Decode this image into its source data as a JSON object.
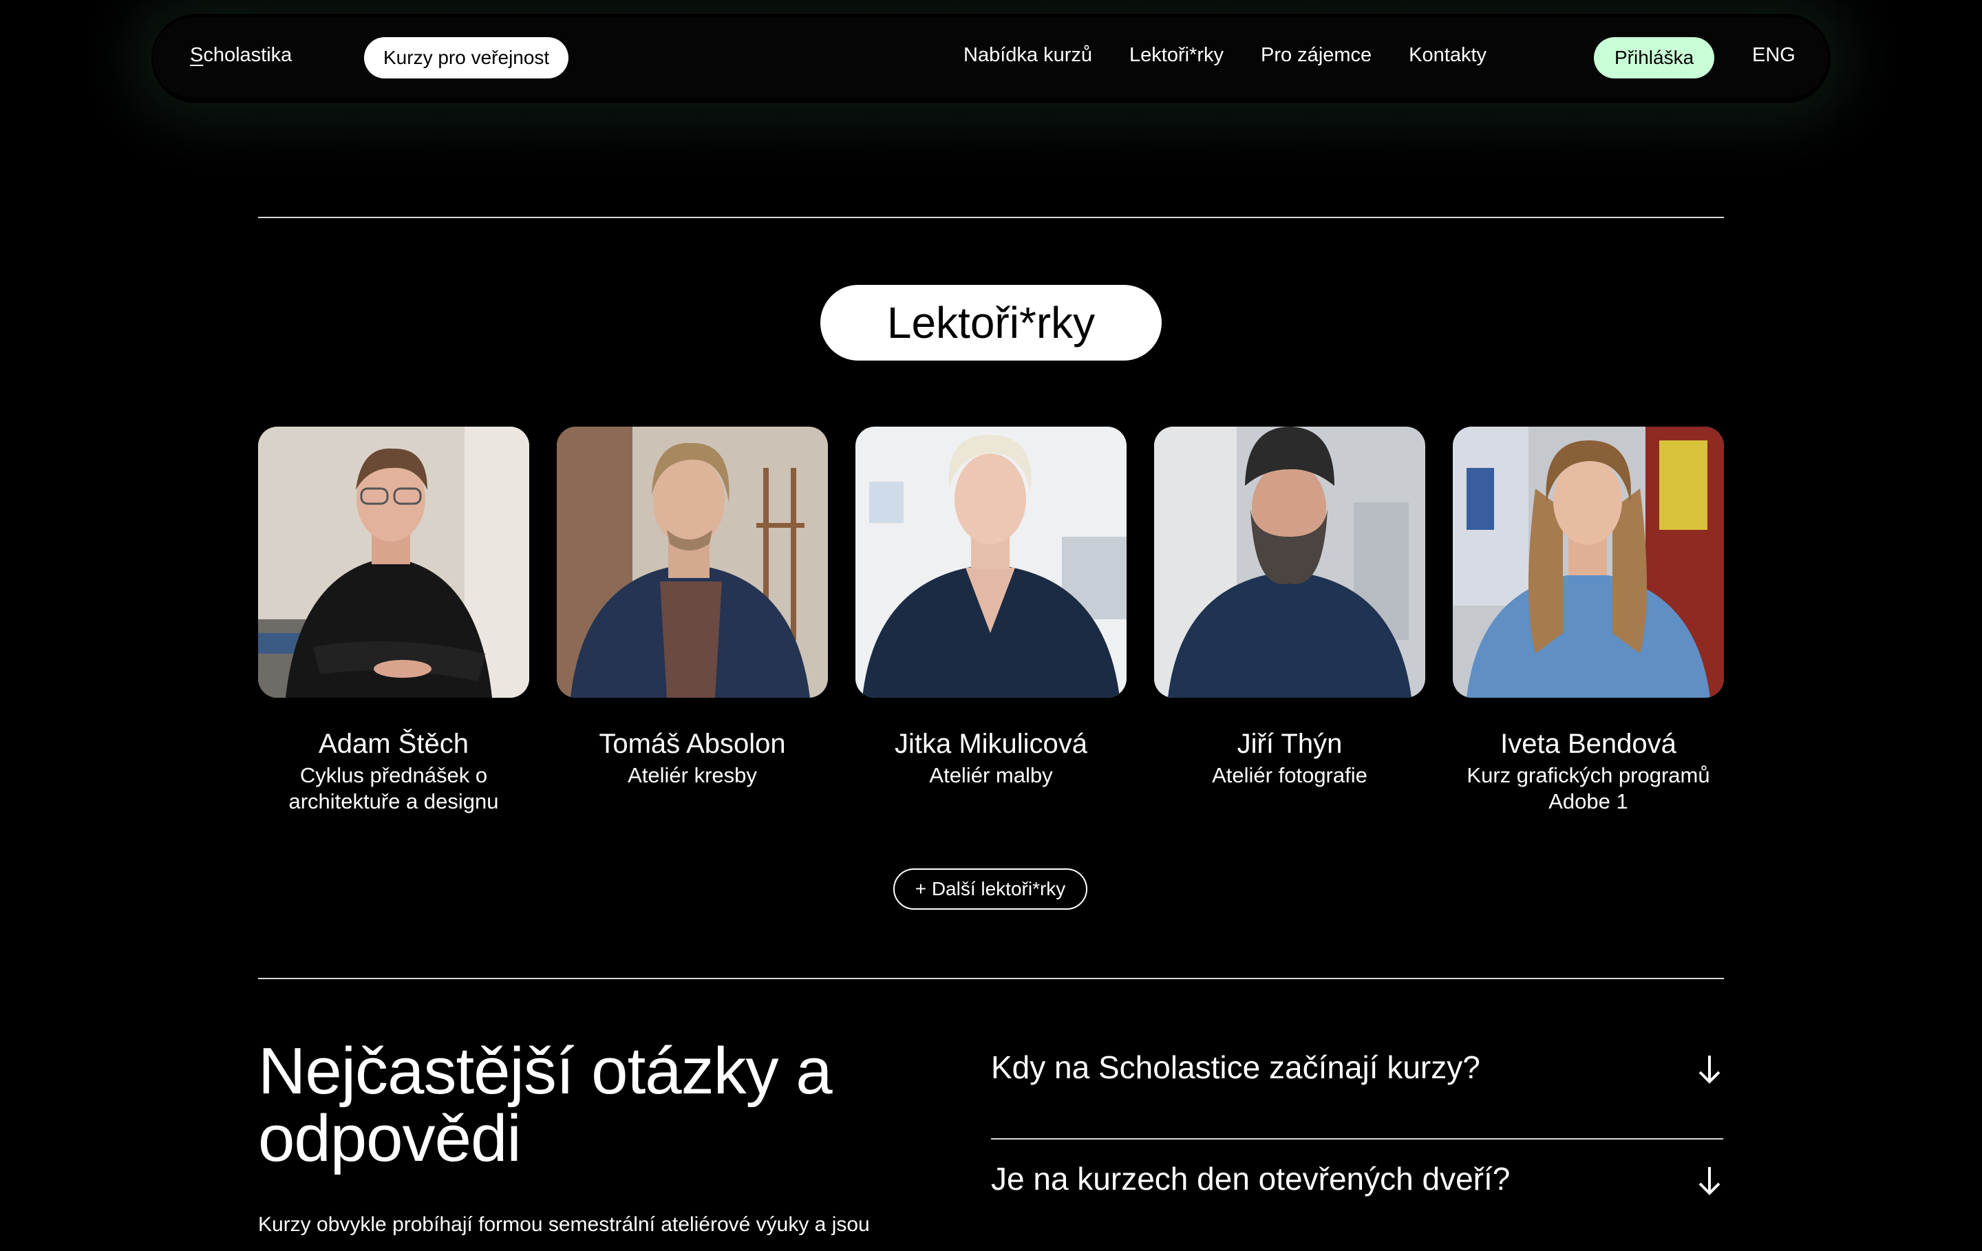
{
  "nav": {
    "brand_first": "S",
    "brand_rest": "cholastika",
    "public_courses": "Kurzy pro veřejnost",
    "links": [
      "Nabídka kurzů",
      "Lektoři*rky",
      "Pro zájemce",
      "Kontakty"
    ],
    "apply": "Přihláška",
    "lang": "ENG"
  },
  "lecturers": {
    "heading": "Lektoři*rky",
    "items": [
      {
        "name": "Adam Štěch",
        "course": "Cyklus přednášek o architektuře a designu"
      },
      {
        "name": "Tomáš Absolon",
        "course": "Ateliér kresby"
      },
      {
        "name": "Jitka Mikulicová",
        "course": "Ateliér malby"
      },
      {
        "name": "Jiří Thýn",
        "course": "Ateliér fotografie"
      },
      {
        "name": "Iveta Bendová",
        "course": "Kurz grafických programů Adobe 1"
      }
    ],
    "more_button": "+ Další lektoři*rky"
  },
  "faq": {
    "title": "Nejčastější otázky a odpovědi",
    "intro": "Kurzy obvykle probíhají formou semestrální ateliérové výuky a jsou",
    "questions": [
      "Kdy na Scholastice začínají kurzy?",
      "Je na kurzech den otevřených dveří?"
    ]
  },
  "colors": {
    "background": "#000000",
    "apply_pill": "#c9ffd6",
    "pill_white": "#ffffff",
    "divider": "#d8d8d8"
  }
}
